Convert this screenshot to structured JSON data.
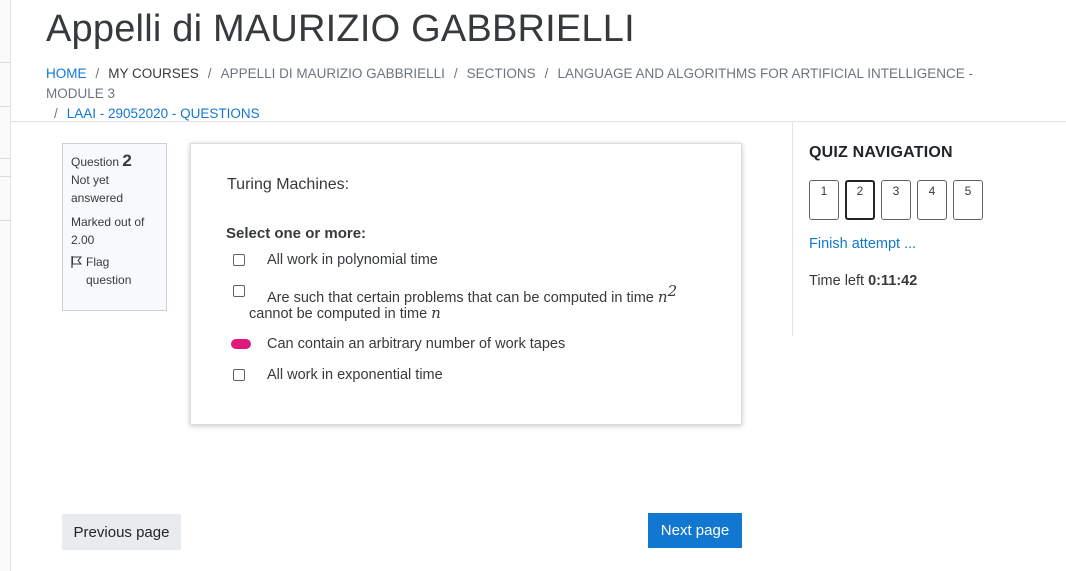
{
  "page": {
    "title": "Appelli di MAURIZIO GABBRIELLI"
  },
  "breadcrumb": {
    "items": [
      "HOME",
      "MY COURSES",
      "APPELLI DI MAURIZIO GABBRIELLI",
      "SECTIONS",
      "LANGUAGE AND ALGORITHMS FOR ARTIFICIAL INTELLIGENCE - MODULE 3",
      "LAAI - 29052020 - QUESTIONS"
    ]
  },
  "question_info": {
    "label": "Question",
    "number": "2",
    "state": "Not yet answered",
    "marked": "Marked out of 2.00",
    "flag_label": "Flag question"
  },
  "question": {
    "text": "Turing Machines:",
    "prompt": "Select one or more:",
    "options": [
      {
        "label": "All work in polynomial time",
        "checked": false
      },
      {
        "label_a": "Are such that certain problems that can be computed in time ",
        "math_a": "n",
        "sup": "2",
        "label_b": "cannot be computed in time ",
        "math_b": "n",
        "checked": false
      },
      {
        "label": "Can contain an arbitrary number of work tapes",
        "checked": true
      },
      {
        "label": "All work in exponential time",
        "checked": false
      }
    ]
  },
  "quiz_navigation": {
    "title": "QUIZ NAVIGATION",
    "buttons": [
      "1",
      "2",
      "3",
      "4",
      "5"
    ],
    "current": "2",
    "finish_label": "Finish attempt ...",
    "time_label": "Time left",
    "time_value": "0:11:42"
  },
  "footer": {
    "prev_label": "Previous page",
    "next_label": "Next page"
  },
  "colors": {
    "link": "#1177d1",
    "checked_mark": "#e0187a",
    "primary_button": "#1177d1"
  }
}
